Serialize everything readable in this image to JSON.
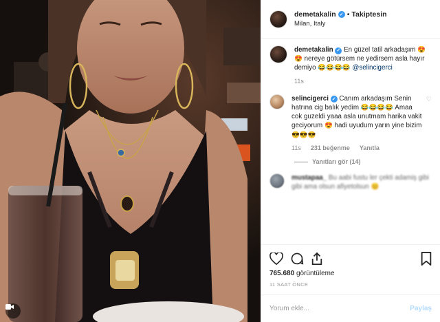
{
  "post": {
    "author": "demetakalin",
    "follow_status": "Takiptesin",
    "location": "Milan, Italy"
  },
  "caption": {
    "author": "demetakalin",
    "text_1": "En güzel tatil arkadaşım",
    "emoji_1": "😍😍",
    "text_2": "nereye götürsem ne yedirsem asla hayır demiyo",
    "emoji_2": "😂😂😂😂",
    "mention": "@selincigerci",
    "time": "11s"
  },
  "comments": [
    {
      "author": "selincigerci",
      "text_1": "Canım arkadaşım Senin hatrına cig balık yedim",
      "emoji_1": "😂😂😂😂",
      "text_2": "Amaa cok guzeldi yaaa asla unutmam harika vakit geciyorum",
      "emoji_2": "😍",
      "text_3": "hadi uyudum yarın yine bizim",
      "emoji_3": "😎😎😎",
      "time": "11s",
      "likes": "231 beğenme",
      "reply_label": "Yanıtla",
      "replies_label": "Yanıtları gör (14)"
    },
    {
      "author": "mustapaa_",
      "text": "Bu aabi fustu ler çekti adamiş gibi gibi ama olsun afiyetolsun",
      "emoji": "😊"
    }
  ],
  "stats": {
    "views_count": "765.680",
    "views_label": "görüntüleme",
    "posted": "11 SAAT ÖNCE"
  },
  "add_comment": {
    "placeholder": "Yorum ekle...",
    "post_label": "Paylaş"
  }
}
